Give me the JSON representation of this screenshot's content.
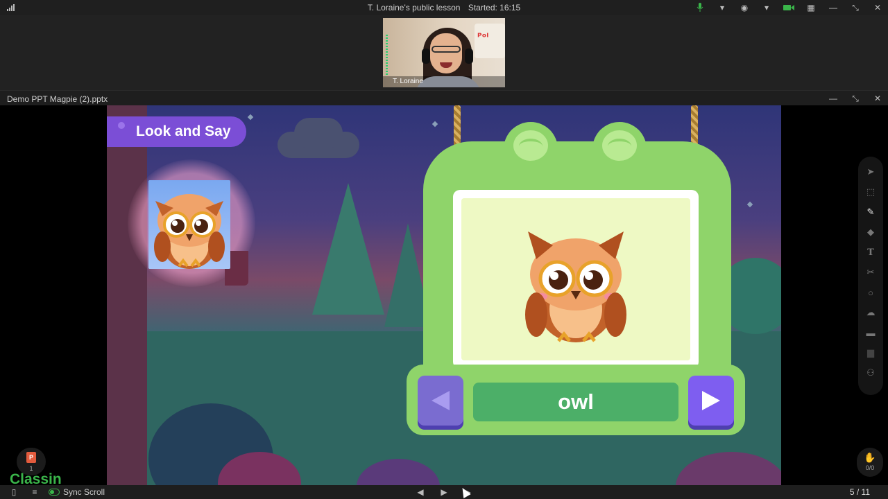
{
  "window": {
    "lesson_title": "T. Loraine's public lesson",
    "started": "Started: 16:15"
  },
  "video": {
    "participant_name": "T. Loraine"
  },
  "document": {
    "filename": "Demo PPT Magpie (2).pptx"
  },
  "slide": {
    "section_label": "Look and Say",
    "word": "owl"
  },
  "toolbar": {
    "tools": [
      "pointer",
      "select",
      "pen",
      "eraser",
      "text",
      "scissors",
      "shape",
      "cloud",
      "toolbox",
      "chat",
      "users"
    ],
    "active_tool": "pen",
    "hand_raise_count": "0/0"
  },
  "bottom": {
    "ppt_count": "1",
    "logo": "Classin",
    "sync_scroll_label": "Sync Scroll",
    "page_indicator": "5 / 11"
  },
  "colors": {
    "accent_green": "#3ab54a",
    "look_say_purple": "#7b4ed6",
    "frog_green": "#8fd46a",
    "word_bar_green": "#4caf68"
  }
}
